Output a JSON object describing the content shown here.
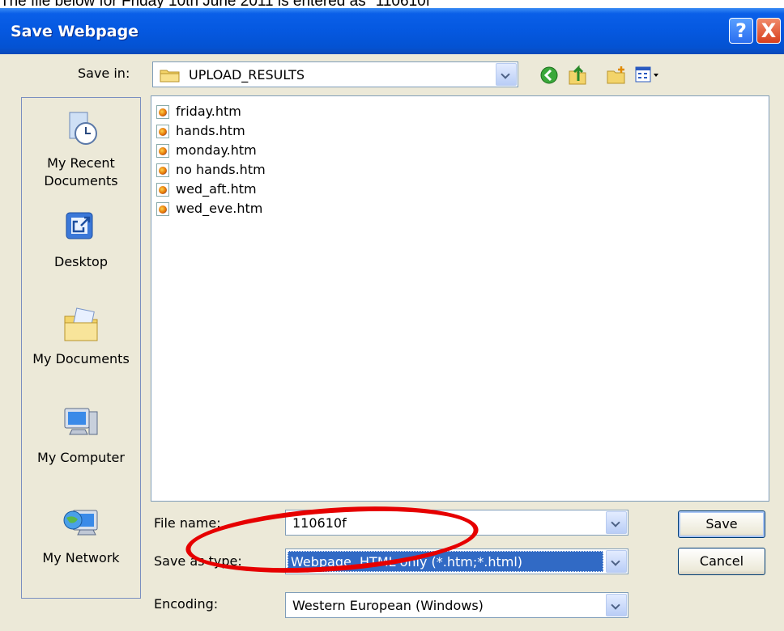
{
  "caption": "The file below for Friday 10th June 2011 is entered as \"110610f\"",
  "dialog": {
    "title": "Save Webpage",
    "help_glyph": "?",
    "close_glyph": "X"
  },
  "save_in": {
    "label": "Save in:",
    "value": "UPLOAD_RESULTS"
  },
  "toolbar_icons": [
    "back-icon",
    "up-folder-icon",
    "new-folder-icon",
    "views-menu-icon"
  ],
  "places": [
    {
      "label_line1": "My Recent",
      "label_line2": "Documents",
      "icon": "recent-documents-icon"
    },
    {
      "label_line1": "Desktop",
      "label_line2": "",
      "icon": "desktop-icon"
    },
    {
      "label_line1": "My Documents",
      "label_line2": "",
      "icon": "my-documents-icon"
    },
    {
      "label_line1": "My Computer",
      "label_line2": "",
      "icon": "my-computer-icon"
    },
    {
      "label_line1": "My Network",
      "label_line2": "",
      "icon": "my-network-icon"
    }
  ],
  "files": [
    "friday.htm",
    "hands.htm",
    "monday.htm",
    "no hands.htm",
    "wed_aft.htm",
    "wed_eve.htm"
  ],
  "file_name": {
    "label": "File name:",
    "value": "110610f"
  },
  "save_as_type": {
    "label": "Save as type:",
    "value": "Webpage, HTML only (*.htm;*.html)"
  },
  "encoding": {
    "label": "Encoding:",
    "value": "Western European (Windows)"
  },
  "buttons": {
    "save": "Save",
    "cancel": "Cancel"
  },
  "colors": {
    "title_bar": "#0558e0",
    "highlight": "#316ac5",
    "annotation_oval": "#e60000"
  }
}
